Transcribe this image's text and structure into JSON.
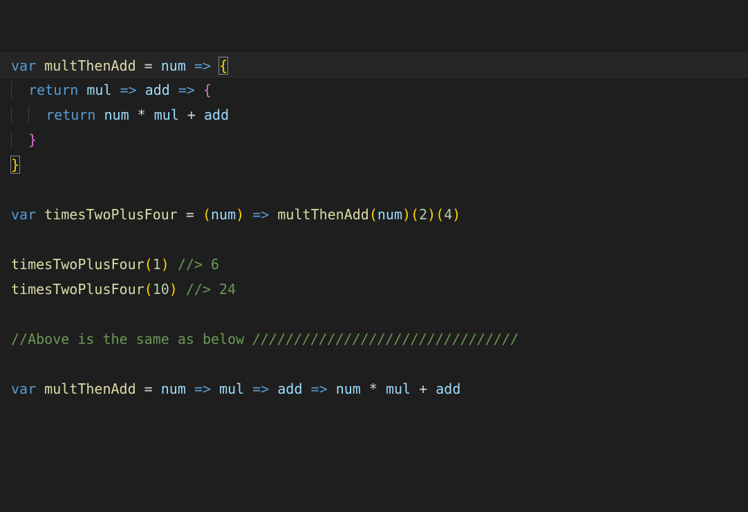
{
  "editor": {
    "language": "javascript",
    "highlighted_line_index": 0,
    "lines": [
      {
        "indent": 0,
        "highlighted": true,
        "tokens": [
          {
            "t": "var ",
            "c": "kw"
          },
          {
            "t": "multThenAdd",
            "c": "fn"
          },
          {
            "t": " ",
            "c": "op"
          },
          {
            "t": "=",
            "c": "op"
          },
          {
            "t": " ",
            "c": "op"
          },
          {
            "t": "num",
            "c": "id"
          },
          {
            "t": " ",
            "c": "op"
          },
          {
            "t": "=>",
            "c": "kw"
          },
          {
            "t": " ",
            "c": "op"
          },
          {
            "t": "{",
            "c": "pnY",
            "match": true
          }
        ]
      },
      {
        "indent": 1,
        "tokens": [
          {
            "t": "return ",
            "c": "kw"
          },
          {
            "t": "mul",
            "c": "id"
          },
          {
            "t": " ",
            "c": "op"
          },
          {
            "t": "=>",
            "c": "kw"
          },
          {
            "t": " ",
            "c": "op"
          },
          {
            "t": "add",
            "c": "id"
          },
          {
            "t": " ",
            "c": "op"
          },
          {
            "t": "=>",
            "c": "kw"
          },
          {
            "t": " ",
            "c": "op"
          },
          {
            "t": "{",
            "c": "pnP"
          }
        ]
      },
      {
        "indent": 2,
        "tokens": [
          {
            "t": "return ",
            "c": "kw"
          },
          {
            "t": "num",
            "c": "id"
          },
          {
            "t": " ",
            "c": "op"
          },
          {
            "t": "*",
            "c": "op"
          },
          {
            "t": " ",
            "c": "op"
          },
          {
            "t": "mul",
            "c": "id"
          },
          {
            "t": " ",
            "c": "op"
          },
          {
            "t": "+",
            "c": "op"
          },
          {
            "t": " ",
            "c": "op"
          },
          {
            "t": "add",
            "c": "id"
          }
        ]
      },
      {
        "indent": 1,
        "tokens": [
          {
            "t": "}",
            "c": "pnP"
          }
        ]
      },
      {
        "indent": 0,
        "tokens": [
          {
            "t": "}",
            "c": "pnY",
            "match": true
          }
        ]
      },
      {
        "indent": 0,
        "tokens": []
      },
      {
        "indent": 0,
        "tokens": [
          {
            "t": "var ",
            "c": "kw"
          },
          {
            "t": "timesTwoPlusFour",
            "c": "fn"
          },
          {
            "t": " ",
            "c": "op"
          },
          {
            "t": "=",
            "c": "op"
          },
          {
            "t": " ",
            "c": "op"
          },
          {
            "t": "(",
            "c": "pnY"
          },
          {
            "t": "num",
            "c": "id"
          },
          {
            "t": ")",
            "c": "pnY"
          },
          {
            "t": " ",
            "c": "op"
          },
          {
            "t": "=>",
            "c": "kw"
          },
          {
            "t": " ",
            "c": "op"
          },
          {
            "t": "multThenAdd",
            "c": "fn"
          },
          {
            "t": "(",
            "c": "pnY"
          },
          {
            "t": "num",
            "c": "id"
          },
          {
            "t": ")",
            "c": "pnY"
          },
          {
            "t": "(",
            "c": "pnY"
          },
          {
            "t": "2",
            "c": "num"
          },
          {
            "t": ")",
            "c": "pnY"
          },
          {
            "t": "(",
            "c": "pnY"
          },
          {
            "t": "4",
            "c": "num"
          },
          {
            "t": ")",
            "c": "pnY"
          }
        ]
      },
      {
        "indent": 0,
        "tokens": []
      },
      {
        "indent": 0,
        "tokens": [
          {
            "t": "timesTwoPlusFour",
            "c": "fn"
          },
          {
            "t": "(",
            "c": "pnY"
          },
          {
            "t": "1",
            "c": "num"
          },
          {
            "t": ")",
            "c": "pnY"
          },
          {
            "t": " ",
            "c": "op"
          },
          {
            "t": "//> 6",
            "c": "cm"
          }
        ]
      },
      {
        "indent": 0,
        "tokens": [
          {
            "t": "timesTwoPlusFour",
            "c": "fn"
          },
          {
            "t": "(",
            "c": "pnY"
          },
          {
            "t": "10",
            "c": "num"
          },
          {
            "t": ")",
            "c": "pnY"
          },
          {
            "t": " ",
            "c": "op"
          },
          {
            "t": "//> 24",
            "c": "cm"
          }
        ]
      },
      {
        "indent": 0,
        "tokens": []
      },
      {
        "indent": 0,
        "tokens": [
          {
            "t": "//Above is the same as below ",
            "c": "cm"
          },
          {
            "t": "////////////////////////////////",
            "c": "cm",
            "italic": true
          }
        ]
      },
      {
        "indent": 0,
        "tokens": []
      },
      {
        "indent": 0,
        "tokens": [
          {
            "t": "var ",
            "c": "kw"
          },
          {
            "t": "multThenAdd",
            "c": "fn"
          },
          {
            "t": " ",
            "c": "op"
          },
          {
            "t": "=",
            "c": "op"
          },
          {
            "t": " ",
            "c": "op"
          },
          {
            "t": "num",
            "c": "id"
          },
          {
            "t": " ",
            "c": "op"
          },
          {
            "t": "=>",
            "c": "kw"
          },
          {
            "t": " ",
            "c": "op"
          },
          {
            "t": "mul",
            "c": "id"
          },
          {
            "t": " ",
            "c": "op"
          },
          {
            "t": "=>",
            "c": "kw"
          },
          {
            "t": " ",
            "c": "op"
          },
          {
            "t": "add",
            "c": "id"
          },
          {
            "t": " ",
            "c": "op"
          },
          {
            "t": "=>",
            "c": "kw"
          },
          {
            "t": " ",
            "c": "op"
          },
          {
            "t": "num",
            "c": "id"
          },
          {
            "t": " ",
            "c": "op"
          },
          {
            "t": "*",
            "c": "op"
          },
          {
            "t": " ",
            "c": "op"
          },
          {
            "t": "mul",
            "c": "id"
          },
          {
            "t": " ",
            "c": "op"
          },
          {
            "t": "+",
            "c": "op"
          },
          {
            "t": " ",
            "c": "op"
          },
          {
            "t": "add",
            "c": "id"
          }
        ]
      }
    ]
  }
}
